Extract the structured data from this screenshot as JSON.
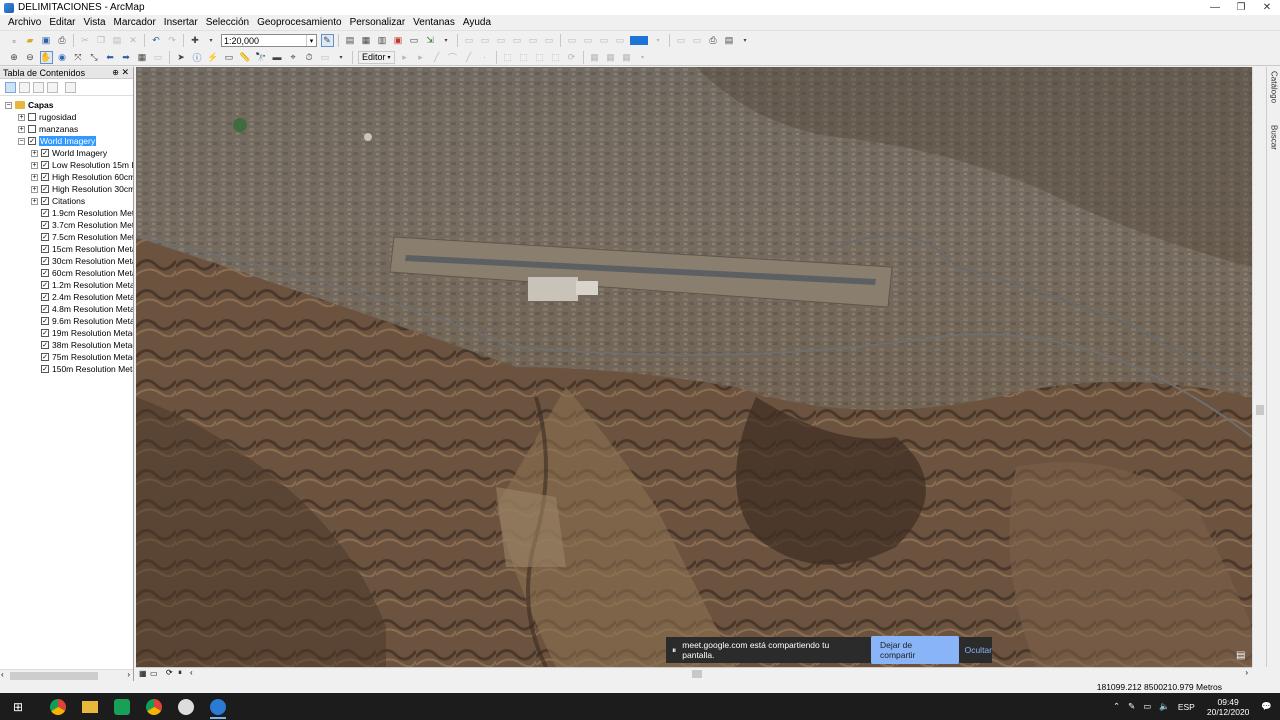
{
  "window": {
    "title": "DELIMITACIONES - ArcMap",
    "minimize": "—",
    "maximize": "❐",
    "close": "✕"
  },
  "menu": [
    "Archivo",
    "Editar",
    "Vista",
    "Marcador",
    "Insertar",
    "Selección",
    "Geoprocesamiento",
    "Personalizar",
    "Ventanas",
    "Ayuda"
  ],
  "toolbar": {
    "scale": "1:20,000",
    "editor_label": "Editor"
  },
  "toc": {
    "title": "Tabla de Contenidos",
    "root": "Capas",
    "layers": [
      {
        "label": "rugosidad",
        "checked": false,
        "level": 1,
        "expand": "+"
      },
      {
        "label": "manzanas",
        "checked": false,
        "level": 1,
        "expand": "+"
      },
      {
        "label": "World Imagery",
        "checked": true,
        "level": 1,
        "expand": "−",
        "selected": true
      },
      {
        "label": "World Imagery",
        "checked": true,
        "level": 2,
        "expand": "+"
      },
      {
        "label": "Low Resolution 15m I",
        "checked": true,
        "level": 2,
        "expand": "+"
      },
      {
        "label": "High Resolution 60cm",
        "checked": true,
        "level": 2,
        "expand": "+"
      },
      {
        "label": "High Resolution 30cm",
        "checked": true,
        "level": 2,
        "expand": "+"
      },
      {
        "label": "Citations",
        "checked": true,
        "level": 2,
        "expand": "+"
      },
      {
        "label": "1.9cm Resolution Met",
        "checked": true,
        "level": 2,
        "expand": ""
      },
      {
        "label": "3.7cm Resolution Met",
        "checked": true,
        "level": 2,
        "expand": ""
      },
      {
        "label": "7.5cm Resolution Met",
        "checked": true,
        "level": 2,
        "expand": ""
      },
      {
        "label": "15cm Resolution Meta",
        "checked": true,
        "level": 2,
        "expand": ""
      },
      {
        "label": "30cm Resolution Meta",
        "checked": true,
        "level": 2,
        "expand": ""
      },
      {
        "label": "60cm Resolution Meta",
        "checked": true,
        "level": 2,
        "expand": ""
      },
      {
        "label": "1.2m Resolution Meta",
        "checked": true,
        "level": 2,
        "expand": ""
      },
      {
        "label": "2.4m Resolution Meta",
        "checked": true,
        "level": 2,
        "expand": ""
      },
      {
        "label": "4.8m Resolution Meta",
        "checked": true,
        "level": 2,
        "expand": ""
      },
      {
        "label": "9.6m Resolution Meta",
        "checked": true,
        "level": 2,
        "expand": ""
      },
      {
        "label": "19m Resolution Metad",
        "checked": true,
        "level": 2,
        "expand": ""
      },
      {
        "label": "38m Resolution Metad",
        "checked": true,
        "level": 2,
        "expand": ""
      },
      {
        "label": "75m Resolution Metad",
        "checked": true,
        "level": 2,
        "expand": ""
      },
      {
        "label": "150m Resolution Meta",
        "checked": true,
        "level": 2,
        "expand": ""
      }
    ]
  },
  "right_tabs": [
    "Catálogo",
    "Buscar"
  ],
  "status": {
    "coordinates": "181099.212  8500210.979 Metros"
  },
  "share_banner": {
    "message": "meet.google.com está compartiendo tu pantalla.",
    "stop_label": "Dejar de compartir",
    "hide_label": "Ocultar"
  },
  "taskbar": {
    "lang": "ESP",
    "time": "09:49",
    "date": "20/12/2020"
  }
}
